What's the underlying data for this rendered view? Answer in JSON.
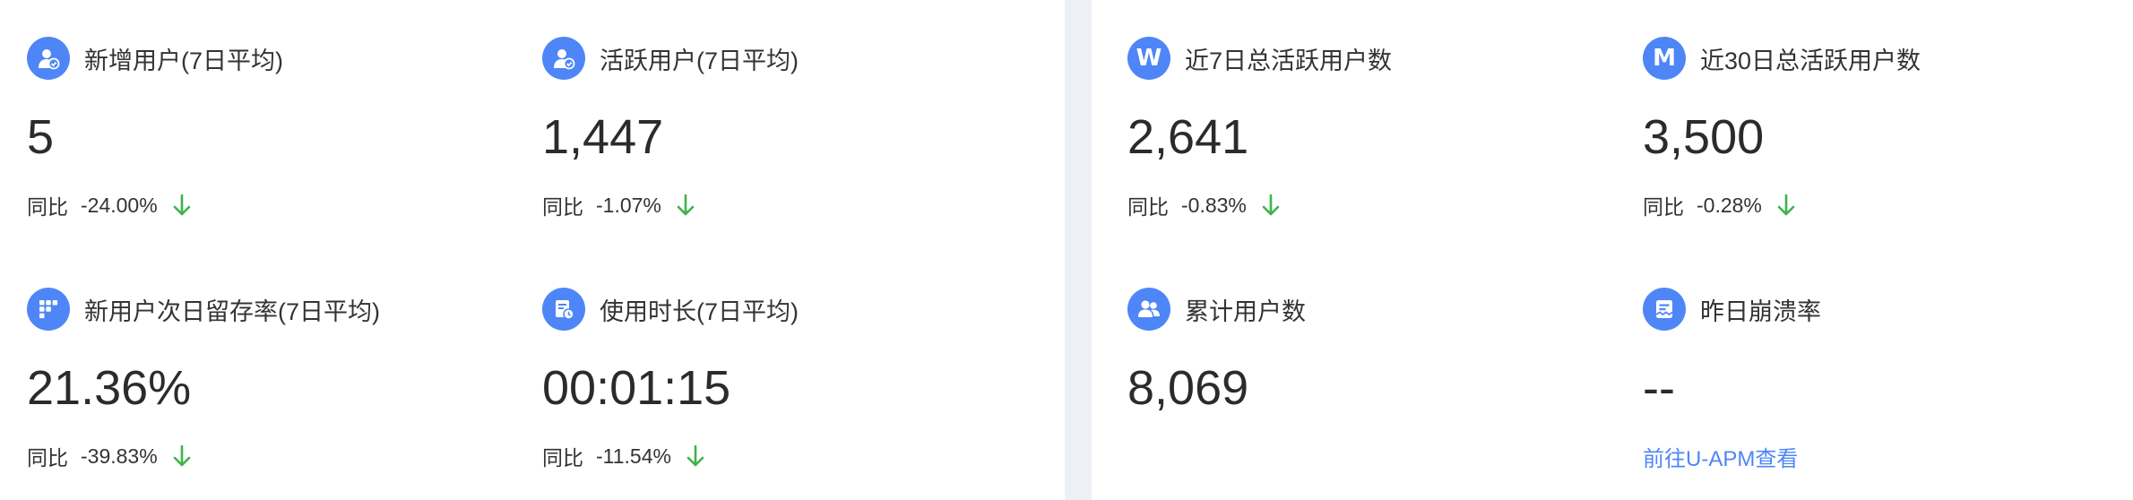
{
  "metrics": [
    {
      "title": "新增用户(7日平均)",
      "value": "5",
      "compare_label": "同比",
      "compare_value": "-24.00%",
      "trend": "down"
    },
    {
      "title": "活跃用户(7日平均)",
      "value": "1,447",
      "compare_label": "同比",
      "compare_value": "-1.07%",
      "trend": "down"
    },
    {
      "title": "新用户次日留存率(7日平均)",
      "value": "21.36%",
      "compare_label": "同比",
      "compare_value": "-39.83%",
      "trend": "down"
    },
    {
      "title": "使用时长(7日平均)",
      "value": "00:01:15",
      "compare_label": "同比",
      "compare_value": "-11.54%",
      "trend": "down"
    },
    {
      "title": "近7日总活跃用户数",
      "icon_letter": "W",
      "value": "2,641",
      "compare_label": "同比",
      "compare_value": "-0.83%",
      "trend": "down"
    },
    {
      "title": "近30日总活跃用户数",
      "icon_letter": "M",
      "value": "3,500",
      "compare_label": "同比",
      "compare_value": "-0.28%",
      "trend": "down"
    },
    {
      "title": "累计用户数",
      "value": "8,069"
    },
    {
      "title": "昨日崩溃率",
      "value": "--",
      "link_label": "前往U-APM查看"
    }
  ],
  "icons": [
    "user-check-icon",
    "user-check-icon",
    "grid-icon",
    "clock-document-icon",
    "week-letter-icon",
    "month-letter-icon",
    "users-icon",
    "crash-document-icon"
  ],
  "colors": {
    "accent": "#4e86f7",
    "trend_down": "#3fb24a",
    "background": "#edf0f5",
    "card": "#ffffff",
    "link": "#4e86f7"
  }
}
